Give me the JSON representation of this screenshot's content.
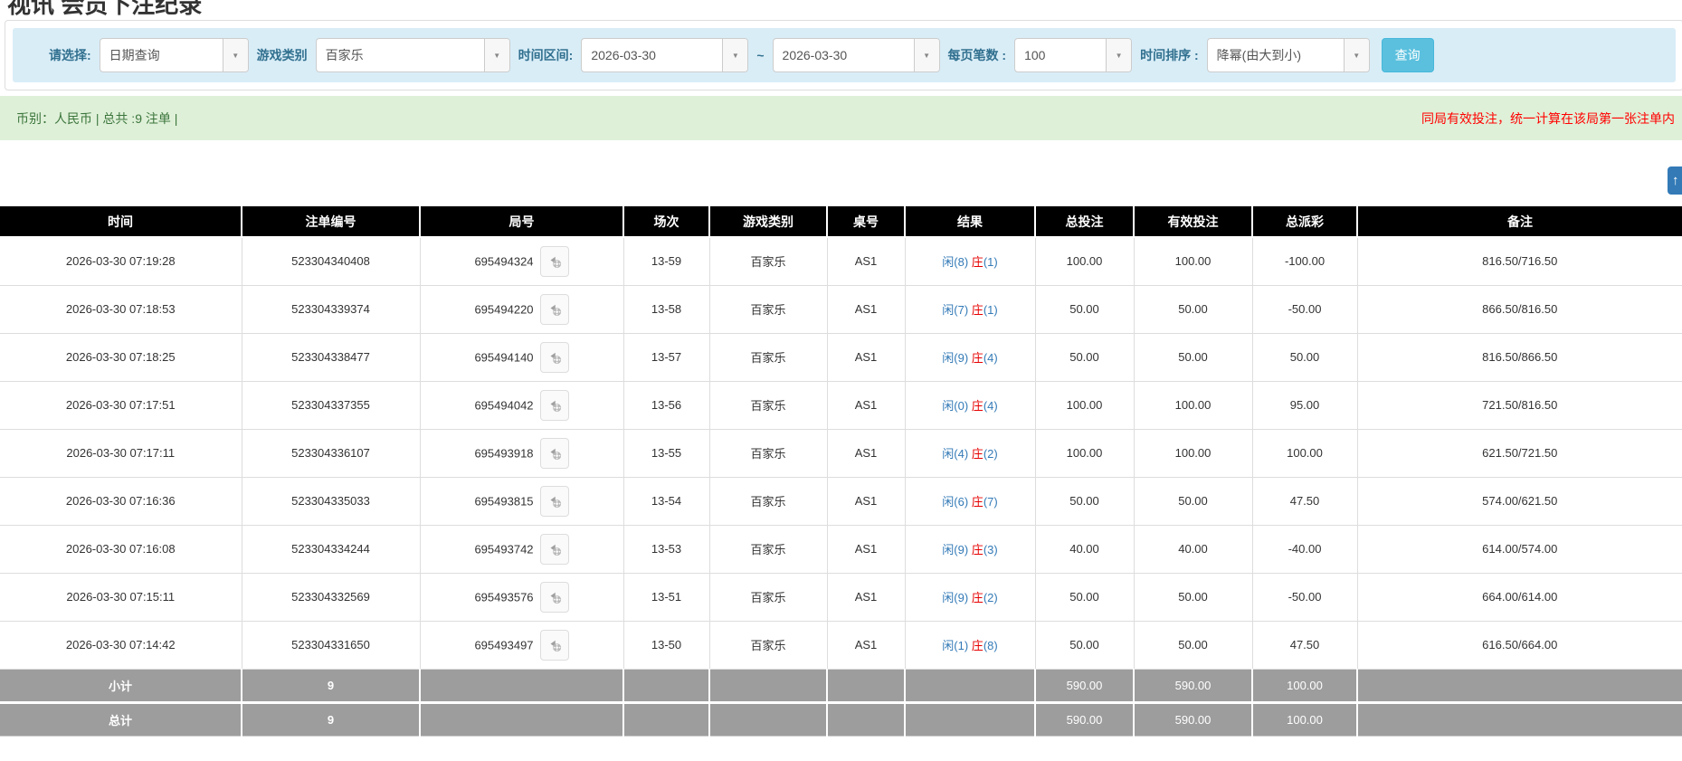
{
  "page": {
    "title": "视讯 会员下注纪录"
  },
  "filters": {
    "select": {
      "label": "请选择:",
      "value": "日期查询"
    },
    "game_type": {
      "label": "游戏类别",
      "value": "百家乐"
    },
    "date_range": {
      "label": "时间区间:",
      "from": "2026-03-30",
      "separator": "~",
      "to": "2026-03-30"
    },
    "page_size": {
      "label": "每页笔数 :",
      "value": "100"
    },
    "sort": {
      "label": "时间排序 :",
      "value": "降幂(由大到小)"
    },
    "search_button_label": "查询"
  },
  "summary": {
    "left_text": "币别：人民币 | 总共 :9 注单 |",
    "right_notice": "同局有效投注，统一计算在该局第一张注单内"
  },
  "icons": {
    "dropdown": "▼",
    "scroll_top": "↑",
    "round_video": "video-film-icon"
  },
  "colors": {
    "filter_bar_bg": "#d9edf7",
    "accent_blue": "#5bc0de",
    "header_bg": "#000000",
    "link_blue": "#337ab7",
    "negative_red": "#e60000",
    "summary_green_bg": "#dff0d8",
    "summary_text_green": "#3c763d",
    "notice_red": "#ff0000",
    "footer_gray": "#9d9d9d"
  },
  "table": {
    "headers": [
      "时间",
      "注单编号",
      "局号",
      "场次",
      "游戏类别",
      "桌号",
      "结果",
      "总投注",
      "有效投注",
      "总派彩",
      "备注"
    ],
    "rows": [
      {
        "time": "2026-03-30 07:19:28",
        "bet_id": "523304340408",
        "round_id": "695494324",
        "session": "13-59",
        "game": "百家乐",
        "table_no": "AS1",
        "result": {
          "player": "闲(8)",
          "banker": "庄",
          "banker_score": "(1)"
        },
        "total_bet": "100.00",
        "valid_bet": "100.00",
        "payout": "-100.00",
        "remark": "816.50/716.50"
      },
      {
        "time": "2026-03-30 07:18:53",
        "bet_id": "523304339374",
        "round_id": "695494220",
        "session": "13-58",
        "game": "百家乐",
        "table_no": "AS1",
        "result": {
          "player": "闲(7)",
          "banker": "庄",
          "banker_score": "(1)"
        },
        "total_bet": "50.00",
        "valid_bet": "50.00",
        "payout": "-50.00",
        "remark": "866.50/816.50"
      },
      {
        "time": "2026-03-30 07:18:25",
        "bet_id": "523304338477",
        "round_id": "695494140",
        "session": "13-57",
        "game": "百家乐",
        "table_no": "AS1",
        "result": {
          "player": "闲(9)",
          "banker": "庄",
          "banker_score": "(4)"
        },
        "total_bet": "50.00",
        "valid_bet": "50.00",
        "payout": "50.00",
        "remark": "816.50/866.50"
      },
      {
        "time": "2026-03-30 07:17:51",
        "bet_id": "523304337355",
        "round_id": "695494042",
        "session": "13-56",
        "game": "百家乐",
        "table_no": "AS1",
        "result": {
          "player": "闲(0)",
          "banker": "庄",
          "banker_score": "(4)"
        },
        "total_bet": "100.00",
        "valid_bet": "100.00",
        "payout": "95.00",
        "remark": "721.50/816.50"
      },
      {
        "time": "2026-03-30 07:17:11",
        "bet_id": "523304336107",
        "round_id": "695493918",
        "session": "13-55",
        "game": "百家乐",
        "table_no": "AS1",
        "result": {
          "player": "闲(4)",
          "banker": "庄",
          "banker_score": "(2)"
        },
        "total_bet": "100.00",
        "valid_bet": "100.00",
        "payout": "100.00",
        "remark": "621.50/721.50"
      },
      {
        "time": "2026-03-30 07:16:36",
        "bet_id": "523304335033",
        "round_id": "695493815",
        "session": "13-54",
        "game": "百家乐",
        "table_no": "AS1",
        "result": {
          "player": "闲(6)",
          "banker": "庄",
          "banker_score": "(7)"
        },
        "total_bet": "50.00",
        "valid_bet": "50.00",
        "payout": "47.50",
        "remark": "574.00/621.50"
      },
      {
        "time": "2026-03-30 07:16:08",
        "bet_id": "523304334244",
        "round_id": "695493742",
        "session": "13-53",
        "game": "百家乐",
        "table_no": "AS1",
        "result": {
          "player": "闲(9)",
          "banker": "庄",
          "banker_score": "(3)"
        },
        "total_bet": "40.00",
        "valid_bet": "40.00",
        "payout": "-40.00",
        "remark": "614.00/574.00"
      },
      {
        "time": "2026-03-30 07:15:11",
        "bet_id": "523304332569",
        "round_id": "695493576",
        "session": "13-51",
        "game": "百家乐",
        "table_no": "AS1",
        "result": {
          "player": "闲(9)",
          "banker": "庄",
          "banker_score": "(2)"
        },
        "total_bet": "50.00",
        "valid_bet": "50.00",
        "payout": "-50.00",
        "remark": "664.00/614.00"
      },
      {
        "time": "2026-03-30 07:14:42",
        "bet_id": "523304331650",
        "round_id": "695493497",
        "session": "13-50",
        "game": "百家乐",
        "table_no": "AS1",
        "result": {
          "player": "闲(1)",
          "banker": "庄",
          "banker_score": "(8)"
        },
        "total_bet": "50.00",
        "valid_bet": "50.00",
        "payout": "47.50",
        "remark": "616.50/664.00"
      }
    ],
    "footer_rows": [
      {
        "label": "小计",
        "count": "9",
        "total_bet": "590.00",
        "valid_bet": "590.00",
        "payout": "100.00"
      },
      {
        "label": "总计",
        "count": "9",
        "total_bet": "590.00",
        "valid_bet": "590.00",
        "payout": "100.00"
      }
    ]
  }
}
